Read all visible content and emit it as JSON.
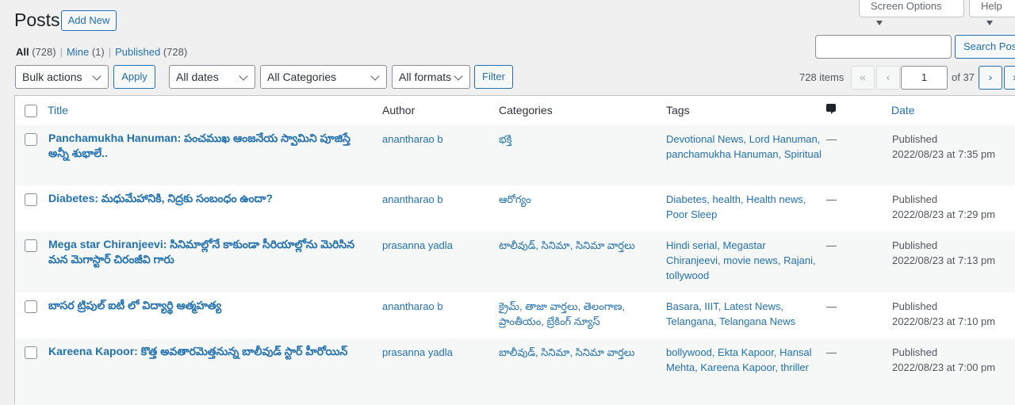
{
  "header": {
    "title": "Posts",
    "add_new": "Add New",
    "screen_options": "Screen Options",
    "help": "Help"
  },
  "views": {
    "all_label": "All",
    "all_count": "(728)",
    "mine_label": "Mine",
    "mine_count": "(1)",
    "published_label": "Published",
    "published_count": "(728)",
    "separator": "|"
  },
  "search": {
    "input_value": "",
    "button": "Search Posts"
  },
  "filters": {
    "bulk_actions": "Bulk actions",
    "apply": "Apply",
    "dates": "All dates",
    "categories": "All Categories",
    "formats": "All formats",
    "filter": "Filter"
  },
  "pagination": {
    "items": "728 items",
    "first": "«",
    "prev": "‹",
    "current": "1",
    "of": "of 37",
    "next": "›",
    "last": "»"
  },
  "columns": {
    "title": "Title",
    "author": "Author",
    "categories": "Categories",
    "tags": "Tags",
    "comments_icon": "comment-icon",
    "date": "Date"
  },
  "rows": [
    {
      "title": "Panchamukha Hanuman: పంచముఖ ఆంజనేయ స్వామిని పూజిస్తే అన్నీ శుభాలే..",
      "author": "anantharao b",
      "categories": "భక్తి",
      "tags": "Devotional News, Lord Hanuman, panchamukha Hanuman, Spiritual",
      "comments": "—",
      "status": "Published",
      "date": "2022/08/23 at 7:35 pm"
    },
    {
      "title": "Diabetes: మధుమేహానికి, నిద్రకు సంబంధం ఉందా?",
      "author": "anantharao b",
      "categories": "ఆరోగ్యం",
      "tags": "Diabetes, health, Health news, Poor Sleep",
      "comments": "—",
      "status": "Published",
      "date": "2022/08/23 at 7:29 pm"
    },
    {
      "title": "Mega star Chiranjeevi: సినిమాల్లోనే కాకుండా సీరియాల్లోను మెరిసిన మన మెగాస్టార్ చిరంజీవి గారు",
      "author": "prasanna yadla",
      "categories": "టాలీవుడ్, సినిమా, సినిమా వార్తలు",
      "tags": "Hindi serial, Megastar Chiranjeevi, movie news, Rajani, tollywood",
      "comments": "—",
      "status": "Published",
      "date": "2022/08/23 at 7:13 pm"
    },
    {
      "title": "బాసర ట్రిపుల్ ఐటీ లో విద్యార్థి ఆత్మహత్య",
      "author": "anantharao b",
      "categories": "క్రైమ్, తాజా వార్తలు, తెలంగాణ, ప్రాంతీయం, బ్రేకింగ్ న్యూస్",
      "tags": "Basara, IIIT, Latest News, Telangana, Telangana News",
      "comments": "—",
      "status": "Published",
      "date": "2022/08/23 at 7:10 pm"
    },
    {
      "title": "Kareena Kapoor: కొత్త అవతారమెత్తనున్న బాలీవుడ్ స్టార్ హీరోయిన్",
      "author": "prasanna yadla",
      "categories": "బాలీవుడ్, సినిమా, సినిమా వార్తలు",
      "tags": "bollywood, Ekta Kapoor, Hansal Mehta, Kareena Kapoor, thriller",
      "comments": "—",
      "status": "Published",
      "date": "2022/08/23 at 7:00 pm"
    }
  ]
}
